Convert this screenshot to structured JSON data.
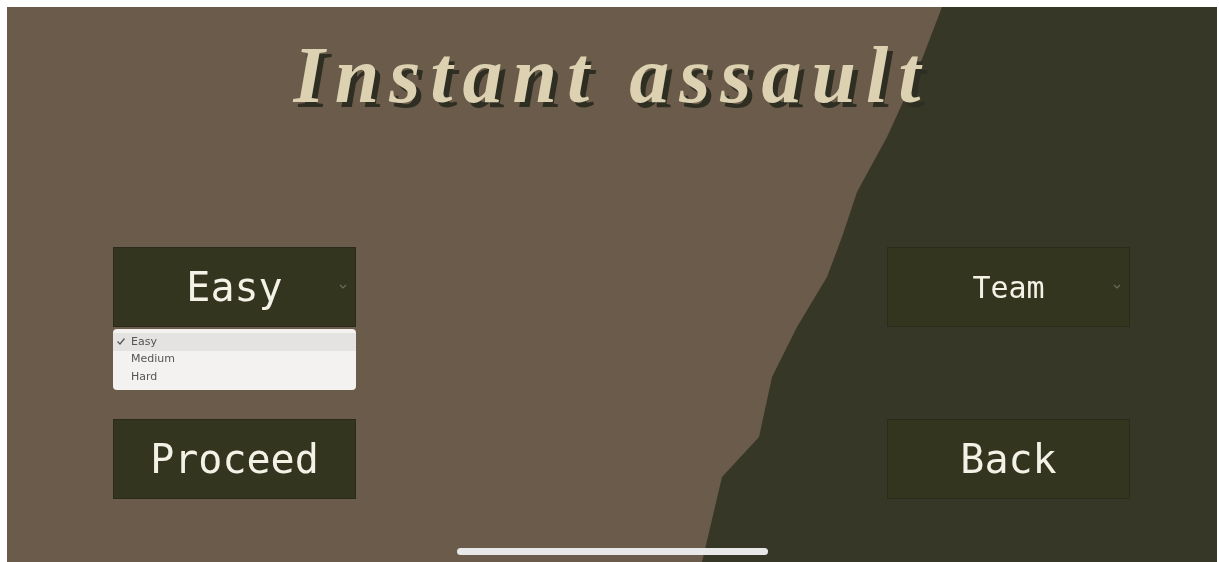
{
  "title": "Instant assault",
  "difficulty": {
    "value": "Easy",
    "options": [
      {
        "label": "Easy",
        "selected": true
      },
      {
        "label": "Medium",
        "selected": false
      },
      {
        "label": "Hard",
        "selected": false
      }
    ]
  },
  "mode": {
    "value": "Team"
  },
  "buttons": [
    "Proceed",
    "Back"
  ]
}
